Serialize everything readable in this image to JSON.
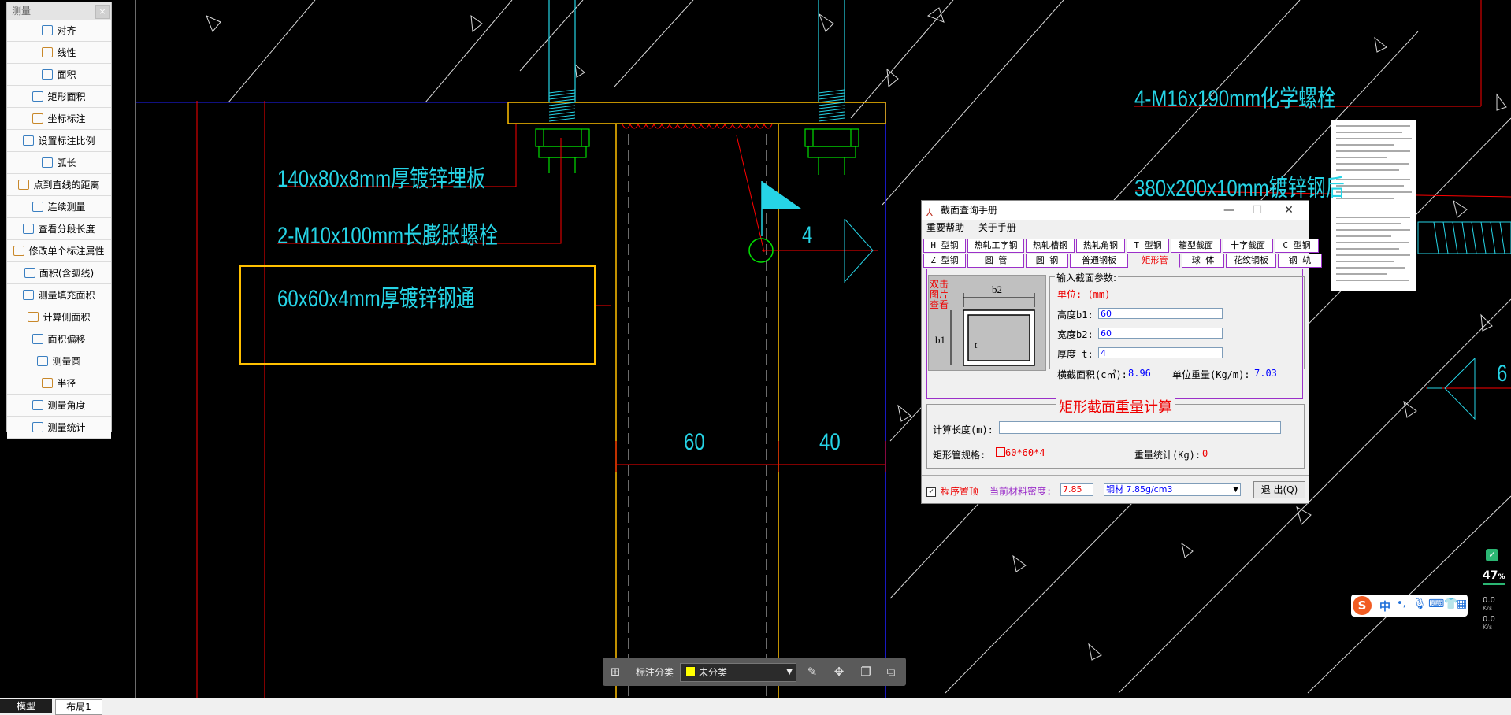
{
  "cad": {
    "labels": {
      "plate": "140x80x8mm厚镀锌埋板",
      "expansion_bolt": "2-M10x100mm长膨胀螺栓",
      "steel_tube": "60x60x4mm厚镀锌钢通",
      "chem_bolt": "4-M16x190mm化学螺栓",
      "steel_plate": "380x200x10mm镀锌钢后",
      "weld_size": "4",
      "dim_60": "60",
      "dim_40": "40",
      "right_cut": "6"
    }
  },
  "measure_panel": {
    "title": "测量",
    "close": "×",
    "items": [
      {
        "label": "对齐",
        "icon": "align-dim-icon"
      },
      {
        "label": "线性",
        "icon": "linear-dim-icon"
      },
      {
        "label": "面积",
        "icon": "area-icon"
      },
      {
        "label": "矩形面积",
        "icon": "rect-area-icon"
      },
      {
        "label": "坐标标注",
        "icon": "coordinate-icon"
      },
      {
        "label": "设置标注比例",
        "icon": "scale-icon"
      },
      {
        "label": "弧长",
        "icon": "arc-length-icon"
      },
      {
        "label": "点到直线的距离",
        "icon": "point-line-icon"
      },
      {
        "label": "连续测量",
        "icon": "continuous-icon"
      },
      {
        "label": "查看分段长度",
        "icon": "segment-icon"
      },
      {
        "label": "修改单个标注属性",
        "icon": "edit-dim-icon"
      },
      {
        "label": "面积(含弧线)",
        "icon": "arc-area-icon"
      },
      {
        "label": "测量填充面积",
        "icon": "hatch-area-icon"
      },
      {
        "label": "计算侧面积",
        "icon": "side-area-icon"
      },
      {
        "label": "面积偏移",
        "icon": "area-offset-icon"
      },
      {
        "label": "测量圆",
        "icon": "circle-icon"
      },
      {
        "label": "半径",
        "icon": "radius-icon"
      },
      {
        "label": "测量角度",
        "icon": "angle-icon"
      },
      {
        "label": "测量统计",
        "icon": "stats-icon"
      }
    ]
  },
  "dialog": {
    "title": "截面查询手册",
    "menu": [
      "重要帮助",
      "关于手册"
    ],
    "tabs_row1": [
      "H 型钢",
      "热轧工字钢",
      "热轧槽钢",
      "热轧角钢",
      "T 型钢",
      "箱型截面",
      "十字截面",
      "C 型钢"
    ],
    "tabs_row2": [
      "Z 型钢",
      "圆 管",
      "圆 钢",
      "普通钢板",
      "矩形管",
      "球 体",
      "花纹钢板",
      "钢 轨"
    ],
    "active_tab": "矩形管",
    "figure_note": "双击图片查看",
    "params_title": "输入截面参数:",
    "unit_label": "单位: (mm)",
    "height_label": "高度b1:",
    "height_value": "60",
    "width_label": "宽度b2:",
    "width_value": "60",
    "thick_label": "厚度 t:",
    "thick_value": "4",
    "area_label": "横截面积(c㎡):",
    "area_value": "8.96",
    "weight_label": "单位重量(Kg/m):",
    "weight_value": "7.03",
    "calc_title": "矩形截面重量计算",
    "length_label": "计算长度(m):",
    "length_value": "",
    "spec_label": "矩形管规格:",
    "spec_value": "60*60*4",
    "total_label": "重量统计(Kg):",
    "total_value": "0",
    "pin_label": "程序置顶",
    "density_label": "当前材料密度:",
    "density_value": "7.85",
    "material_value": "钢材 7.85g/cm3",
    "exit_label": "退 出(Q)"
  },
  "float_toolbar": {
    "category_label": "标注分类",
    "category_value": "未分类",
    "category_color": "#ffff00"
  },
  "status": {
    "tabs": [
      "模型",
      "布局1"
    ],
    "net_percent": "47",
    "net_unit": "%",
    "up_speed": "0.0",
    "down_speed": "0.0",
    "speed_unit": "K/s"
  },
  "ime": {
    "lang": "中"
  },
  "colors": {
    "cad_cyan": "#26d4e6",
    "cad_red": "#ff0000",
    "cad_yellow": "#ffc000",
    "cad_blue": "#2020ff",
    "tab_border": "#9b30c9"
  }
}
